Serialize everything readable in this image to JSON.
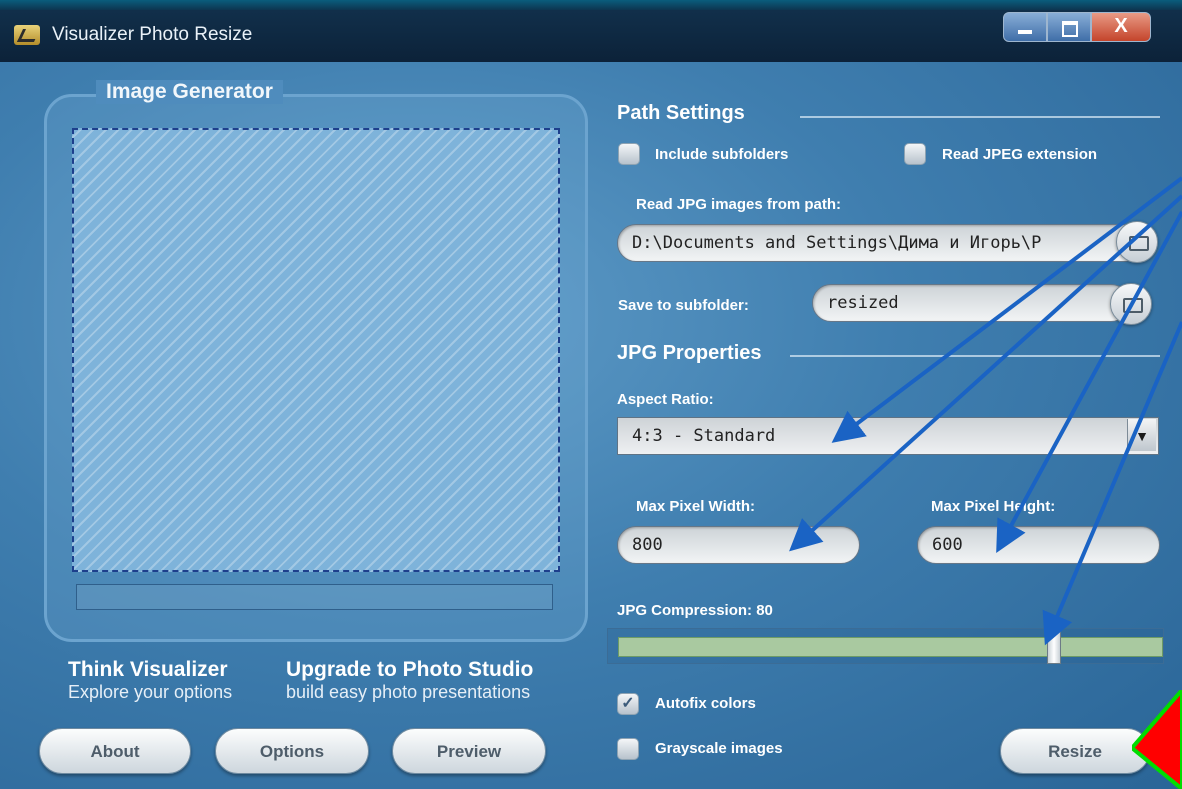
{
  "window": {
    "title": "Visualizer Photo Resize",
    "controls": {
      "close_glyph": "X"
    }
  },
  "image_generator": {
    "title": "Image Generator"
  },
  "promo": {
    "think_title": "Think Visualizer",
    "think_subtitle": "Explore your options",
    "upgrade_title": "Upgrade to Photo Studio",
    "upgrade_subtitle": "build easy photo presentations"
  },
  "buttons": {
    "about": "About",
    "options": "Options",
    "preview": "Preview",
    "resize": "Resize"
  },
  "path_settings": {
    "title": "Path Settings",
    "include_subfolders": {
      "label": "Include subfolders",
      "checked": false
    },
    "read_jpeg_extension": {
      "label": "Read JPEG extension",
      "checked": false
    },
    "read_path_label": "Read JPG images from path:",
    "read_path_value": "D:\\Documents and Settings\\Дима и Игорь\\Р",
    "save_subfolder_label": "Save to subfolder:",
    "save_subfolder_value": "resized"
  },
  "jpg_properties": {
    "title": "JPG Properties",
    "aspect_ratio_label": "Aspect Ratio:",
    "aspect_ratio_value": "4:3  - Standard",
    "max_width_label": "Max Pixel Width:",
    "max_width_value": "800",
    "max_height_label": "Max Pixel Height:",
    "max_height_value": "600",
    "compression_label": "JPG Compression: 80",
    "compression_value": 80,
    "autofix": {
      "label": "Autofix colors",
      "checked": true
    },
    "grayscale": {
      "label": "Grayscale images",
      "checked": false
    }
  },
  "colors": {
    "background": "#3f7eaf",
    "annotation_arrow": "#1a63c4",
    "annotation_triangle": "#ff0000",
    "annotation_triangle_border": "#00dd00",
    "slider_fill": "#a9c9a0"
  }
}
